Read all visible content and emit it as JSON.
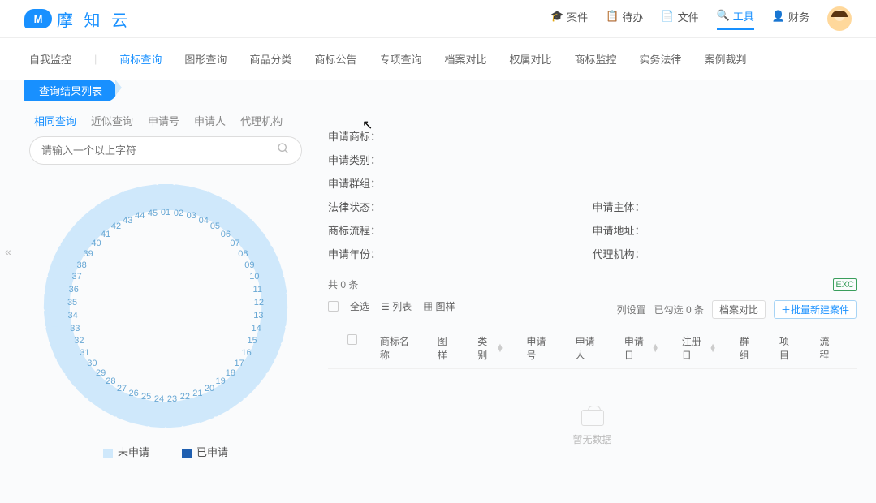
{
  "header": {
    "logo_badge": "M",
    "logo_text": "摩 知 云",
    "nav": [
      {
        "icon": "🎓",
        "label": "案件"
      },
      {
        "icon": "📋",
        "label": "待办"
      },
      {
        "icon": "📄",
        "label": "文件"
      },
      {
        "icon": "🔍",
        "label": "工具",
        "active": true
      },
      {
        "icon": "👤",
        "label": "财务"
      }
    ]
  },
  "subnav": {
    "items": [
      "自我监控",
      "商标查询",
      "图形查询",
      "商品分类",
      "商标公告",
      "专项查询",
      "档案对比",
      "权属对比",
      "商标监控",
      "实务法律",
      "案例裁判"
    ],
    "active_index": 1
  },
  "ribbon": "查询结果列表",
  "query_tabs": {
    "items": [
      "相同查询",
      "近似查询",
      "申请号",
      "申请人",
      "代理机构"
    ],
    "active_index": 0
  },
  "search": {
    "placeholder": "请输入一个以上字符"
  },
  "wheel": {
    "count": 45
  },
  "legend": {
    "unapplied": {
      "label": "未申请",
      "color": "#cfe8fb"
    },
    "applied": {
      "label": "已申请",
      "color": "#1f5fb0"
    }
  },
  "info": {
    "left": [
      {
        "k": "申请商标",
        "v": ""
      },
      {
        "k": "申请类别",
        "v": ""
      },
      {
        "k": "申请群组",
        "v": ""
      }
    ],
    "pair": [
      {
        "lk": "法律状态",
        "lv": "",
        "rk": "申请主体",
        "rv": ""
      },
      {
        "lk": "商标流程",
        "lv": "",
        "rk": "申请地址",
        "rv": ""
      },
      {
        "lk": "申请年份",
        "lv": "",
        "rk": "代理机构",
        "rv": ""
      }
    ]
  },
  "total_label": "共 0 条",
  "toolbar": {
    "col_settings": "列设置",
    "checked": "已勾选 0 条",
    "compare": "档案对比",
    "batch": "＋批量新建案件",
    "excel": "EXC"
  },
  "list_controls": {
    "select_all": "全选",
    "list_view": "列表",
    "grid_view": "图样"
  },
  "columns": [
    "商标名称",
    "图样",
    "类别",
    "申请号",
    "申请人",
    "申请日",
    "注册日",
    "群组",
    "项目",
    "流程"
  ],
  "sortable_cols": [
    2,
    5,
    6
  ],
  "empty": "暂无数据"
}
